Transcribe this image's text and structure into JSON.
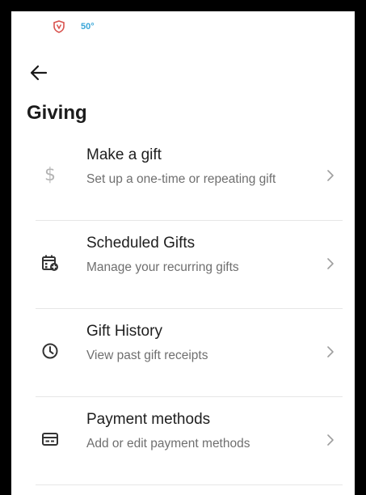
{
  "status_bar": {
    "temperature": "50°",
    "icons": [
      "shield-icon"
    ]
  },
  "header": {
    "back_icon": "arrow-left-icon",
    "title": "Giving"
  },
  "menu": {
    "items": [
      {
        "id": "make-a-gift",
        "icon": "dollar-icon",
        "title": "Make a gift",
        "subtitle": "Set up a one-time or repeating gift"
      },
      {
        "id": "scheduled-gifts",
        "icon": "calendar-add-icon",
        "title": "Scheduled Gifts",
        "subtitle": "Manage your recurring gifts"
      },
      {
        "id": "gift-history",
        "icon": "clock-icon",
        "title": "Gift History",
        "subtitle": "View past gift receipts"
      },
      {
        "id": "payment-methods",
        "icon": "credit-card-icon",
        "title": "Payment methods",
        "subtitle": "Add or edit payment methods"
      }
    ],
    "chevron_icon": "chevron-right-icon"
  },
  "colors": {
    "background": "#ffffff",
    "frame": "#000000",
    "text_primary": "#1e1e1e",
    "text_secondary": "#6f6f6f",
    "divider": "#e6e6e6",
    "status_temp": "#3aa6d8",
    "status_shield": "#d9534f"
  }
}
